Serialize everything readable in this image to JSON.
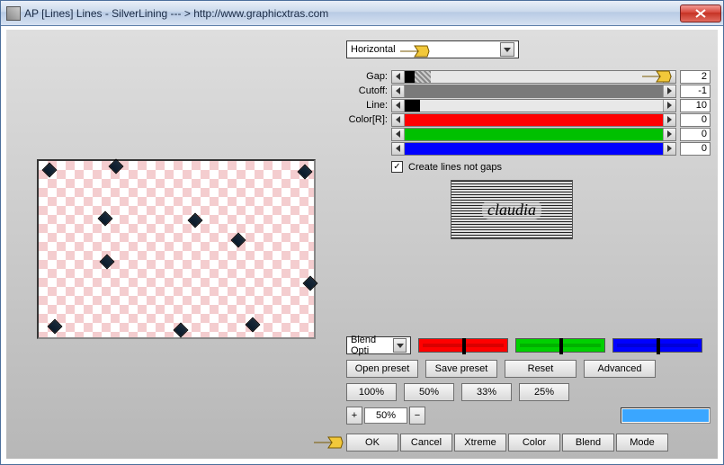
{
  "window": {
    "title": "AP [Lines]  Lines - SilverLining   --- >  http://www.graphicxtras.com"
  },
  "orientation": {
    "selected": "Horizontal"
  },
  "sliders": {
    "gap": {
      "label": "Gap:",
      "value": "2",
      "fill_color": "#000000",
      "fill_pct": 4
    },
    "cutoff": {
      "label": "Cutoff:",
      "value": "-1",
      "fill_color": "#777777",
      "fill_pct": 100
    },
    "line": {
      "label": "Line:",
      "value": "10",
      "fill_color": "#000000",
      "fill_pct": 6
    },
    "r": {
      "label": "Color[R]:",
      "value": "0",
      "fill_color": "#ff0000",
      "fill_pct": 100
    },
    "g": {
      "label": "",
      "value": "0",
      "fill_color": "#00c000",
      "fill_pct": 100
    },
    "b": {
      "label": "",
      "value": "0",
      "fill_color": "#0000ff",
      "fill_pct": 100
    }
  },
  "checkbox": {
    "label": "Create lines not gaps",
    "checked": true
  },
  "logo_text": "claudia",
  "blend": {
    "dropdown": "Blend Opti"
  },
  "buttons": {
    "open_preset": "Open preset",
    "save_preset": "Save preset",
    "reset": "Reset",
    "advanced": "Advanced",
    "p100": "100%",
    "p50": "50%",
    "p33": "33%",
    "p25": "25%",
    "plus": "+",
    "minus": "−",
    "percent_value": "50%",
    "ok": "OK",
    "cancel": "Cancel",
    "xtreme": "Xtreme",
    "color": "Color",
    "blend": "Blend",
    "mode": "Mode"
  },
  "swatch_color": "#5eb3ff"
}
